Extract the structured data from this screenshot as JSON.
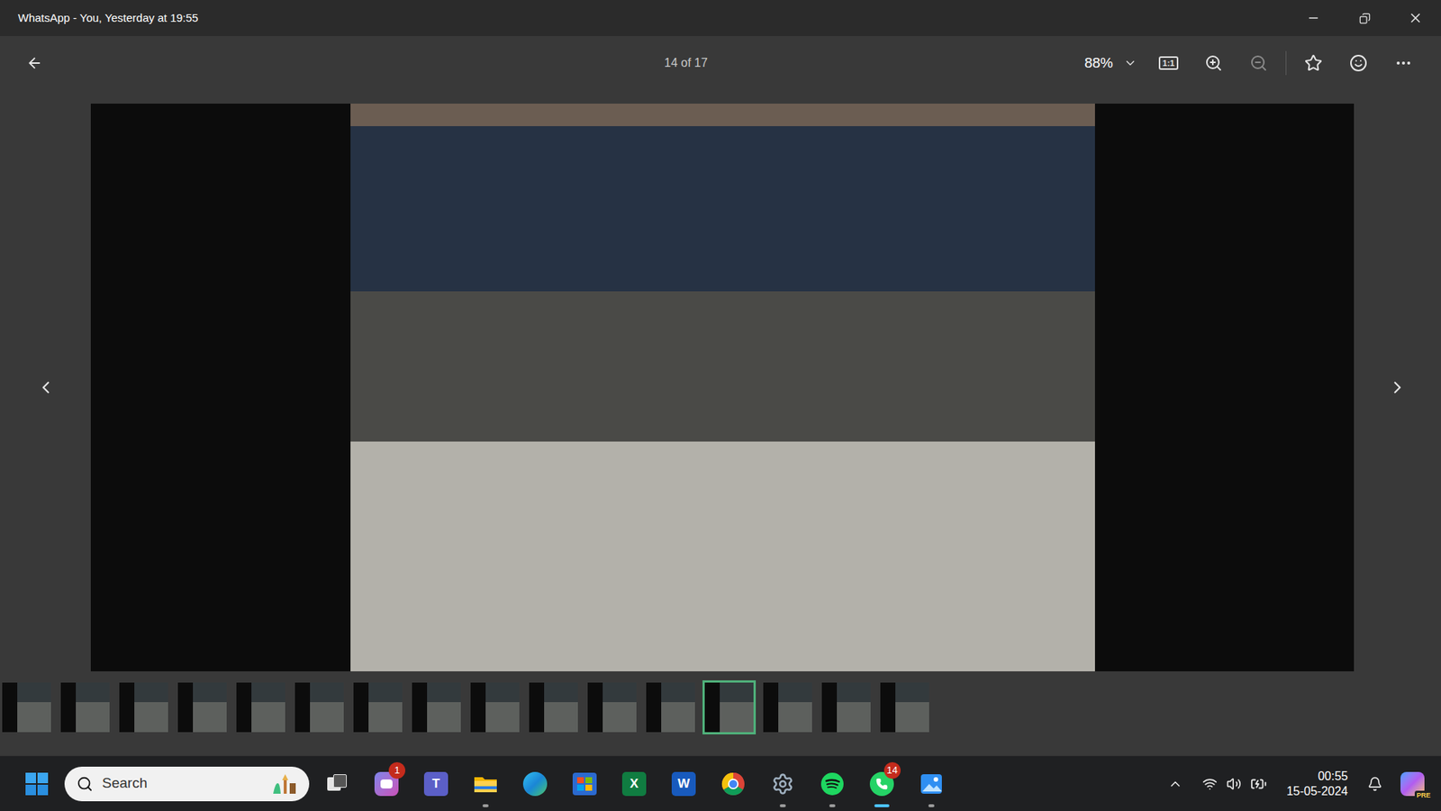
{
  "window": {
    "title": "WhatsApp - You, Yesterday at 19:55"
  },
  "toolbar": {
    "counter": "14 of 17",
    "zoom": "88%",
    "actual_size": "1:1"
  },
  "filmstrip": [
    {
      "selected": false
    },
    {
      "selected": false
    },
    {
      "selected": false
    },
    {
      "selected": false
    },
    {
      "selected": false
    },
    {
      "selected": false
    },
    {
      "selected": false
    },
    {
      "selected": false
    },
    {
      "selected": false
    },
    {
      "selected": false
    },
    {
      "selected": false
    },
    {
      "selected": false
    },
    {
      "selected": true
    },
    {
      "selected": false
    },
    {
      "selected": false
    },
    {
      "selected": false
    }
  ],
  "taskbar": {
    "search": {
      "placeholder": "Search"
    },
    "apps": [
      {
        "kind": "taskview",
        "glyph": "",
        "badge": "",
        "running": false,
        "active": false
      },
      {
        "kind": "chat",
        "glyph": "",
        "badge": "1",
        "running": false,
        "active": false
      },
      {
        "kind": "teams",
        "glyph": "T",
        "badge": "",
        "running": false,
        "active": false
      },
      {
        "kind": "explorer",
        "glyph": "",
        "badge": "",
        "running": true,
        "active": false
      },
      {
        "kind": "edge",
        "glyph": "",
        "badge": "",
        "running": false,
        "active": false
      },
      {
        "kind": "store",
        "glyph": "",
        "badge": "",
        "running": false,
        "active": false
      },
      {
        "kind": "excel",
        "glyph": "X",
        "badge": "",
        "running": false,
        "active": false
      },
      {
        "kind": "word",
        "glyph": "W",
        "badge": "",
        "running": false,
        "active": false
      },
      {
        "kind": "chrome",
        "glyph": "",
        "badge": "",
        "running": false,
        "active": false
      },
      {
        "kind": "settings",
        "glyph": "",
        "badge": "",
        "running": true,
        "active": false
      },
      {
        "kind": "spotify",
        "glyph": "",
        "badge": "",
        "running": true,
        "active": false
      },
      {
        "kind": "whatsapp",
        "glyph": "",
        "badge": "14",
        "running": true,
        "active": true
      },
      {
        "kind": "photos",
        "glyph": "",
        "badge": "",
        "running": true,
        "active": false
      }
    ],
    "tray": {
      "time": "00:55",
      "date": "15-05-2024",
      "copilot_badge": "PRE"
    }
  }
}
